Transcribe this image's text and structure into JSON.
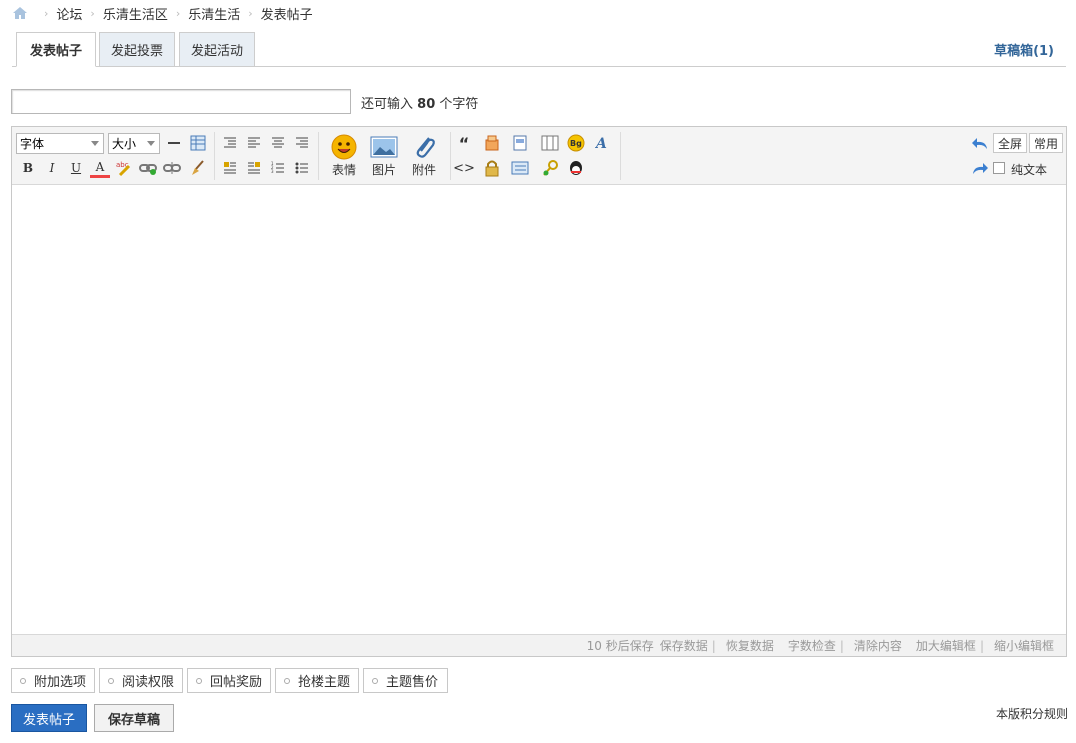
{
  "breadcrumb": {
    "items": [
      "论坛",
      "乐清生活区",
      "乐清生活"
    ],
    "current": "发表帖子"
  },
  "tabs": [
    {
      "label": "发表帖子",
      "active": true
    },
    {
      "label": "发起投票",
      "active": false
    },
    {
      "label": "发起活动",
      "active": false
    }
  ],
  "draft_box": "草稿箱(1)",
  "subject": {
    "value": "",
    "remaining_prefix": "还可输入",
    "remaining_count": "80",
    "remaining_suffix": "个字符"
  },
  "toolbar": {
    "font_select": "字体",
    "size_select": "大小",
    "emoticon_label": "表情",
    "image_label": "图片",
    "attachment_label": "附件",
    "fullscreen_label": "全屏",
    "common_label": "常用",
    "plain_text_label": "纯文本",
    "bold": "B",
    "italic": "I",
    "underline": "U",
    "font_color": "A",
    "quote_glyph": "“",
    "code_glyph": "<>"
  },
  "statusbar": {
    "autosave": "10 秒后保存",
    "save_data": "保存数据",
    "restore_data": "恢复数据",
    "word_check": "字数检查",
    "clear_content": "清除内容",
    "enlarge": "加大编辑框",
    "shrink": "缩小编辑框"
  },
  "options": [
    "附加选项",
    "阅读权限",
    "回帖奖励",
    "抢楼主题",
    "主题售价"
  ],
  "buttons": {
    "submit": "发表帖子",
    "save_draft": "保存草稿"
  },
  "rules_link": "本版积分规则",
  "colors": {
    "accent": "#2a6ec2",
    "link": "#336699",
    "tab_bg": "#e8eef4"
  }
}
